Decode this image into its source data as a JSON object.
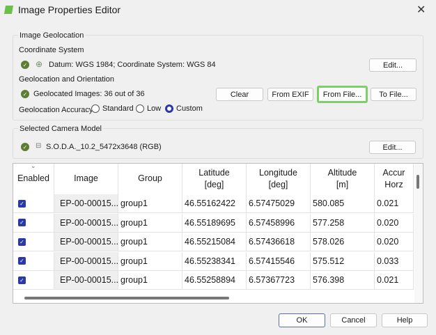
{
  "window": {
    "title": "Image Properties Editor",
    "close": "✕"
  },
  "geolocation": {
    "group_label": "Image Geolocation",
    "coord_label": "Coordinate System",
    "coord_text": "Datum: WGS 1984; Coordinate System: WGS 84",
    "edit": "Edit...",
    "geo_orient_label": "Geolocation and Orientation",
    "geolocated_text": "Geolocated Images: 36 out of 36",
    "buttons": {
      "clear": "Clear",
      "from_exif": "From EXIF",
      "from_file": "From File...",
      "to_file": "To File..."
    },
    "accuracy_label": "Geolocation Accuracy:",
    "accuracy_options": [
      "Standard",
      "Low",
      "Custom"
    ],
    "accuracy_selected": "Custom"
  },
  "camera": {
    "group_label": "Selected Camera Model",
    "model": "S.O.D.A._10.2_5472x3648 (RGB)",
    "edit": "Edit..."
  },
  "table": {
    "headers": [
      "Enabled",
      "Image",
      "Group",
      "Latitude\n[deg]",
      "Longitude\n[deg]",
      "Altitude\n[m]",
      "Accur\nHorz"
    ],
    "rows": [
      {
        "image": "EP-00-00015...",
        "group": "group1",
        "lat": "46.55162422",
        "lon": "6.57475029",
        "alt": "580.085",
        "acc": "0.021"
      },
      {
        "image": "EP-00-00015...",
        "group": "group1",
        "lat": "46.55189695",
        "lon": "6.57458996",
        "alt": "577.258",
        "acc": "0.020"
      },
      {
        "image": "EP-00-00015...",
        "group": "group1",
        "lat": "46.55215084",
        "lon": "6.57436618",
        "alt": "578.026",
        "acc": "0.020"
      },
      {
        "image": "EP-00-00015...",
        "group": "group1",
        "lat": "46.55238341",
        "lon": "6.57415546",
        "alt": "575.512",
        "acc": "0.033"
      },
      {
        "image": "EP-00-00015...",
        "group": "group1",
        "lat": "46.55258894",
        "lon": "6.57367723",
        "alt": "576.398",
        "acc": "0.021"
      }
    ]
  },
  "footer": {
    "ok": "OK",
    "cancel": "Cancel",
    "help": "Help"
  }
}
